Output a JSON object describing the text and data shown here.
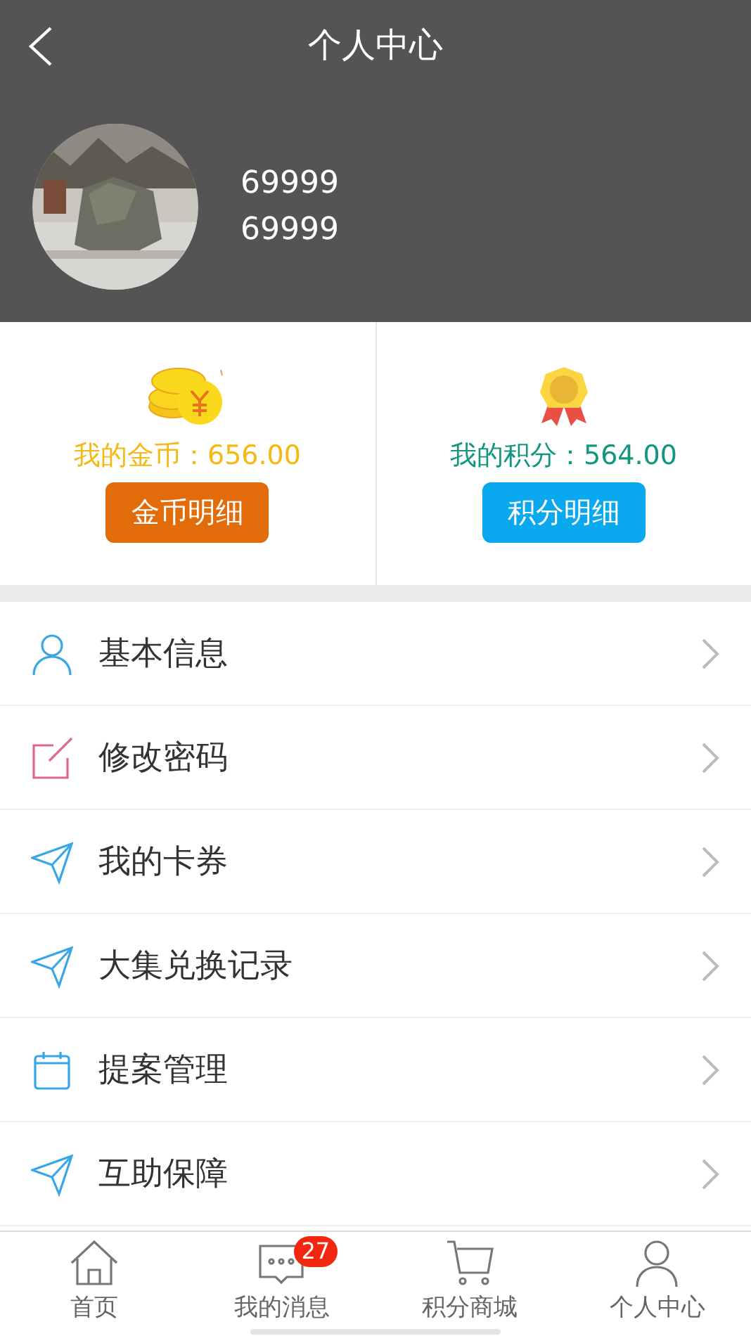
{
  "header": {
    "title": "个人中心",
    "user_lines": [
      "69999",
      "69999"
    ]
  },
  "wallets": [
    {
      "kind": "coins",
      "label": "我的金币：656.00",
      "button": "金币明细"
    },
    {
      "kind": "medal",
      "label": "我的积分：564.00",
      "button": "积分明细"
    }
  ],
  "menu": [
    {
      "kind": "person",
      "label": "基本信息"
    },
    {
      "kind": "edit",
      "label": "修改密码"
    },
    {
      "kind": "send",
      "label": "我的卡券"
    },
    {
      "kind": "send",
      "label": "大集兑换记录"
    },
    {
      "kind": "calendar",
      "label": "提案管理"
    },
    {
      "kind": "send",
      "label": "互助保障"
    }
  ],
  "tab_bar": [
    {
      "kind": "home",
      "label": "首页"
    },
    {
      "kind": "message",
      "label": "我的消息",
      "badge": "27"
    },
    {
      "kind": "cart",
      "label": "积分商城"
    },
    {
      "kind": "person",
      "label": "个人中心"
    }
  ]
}
